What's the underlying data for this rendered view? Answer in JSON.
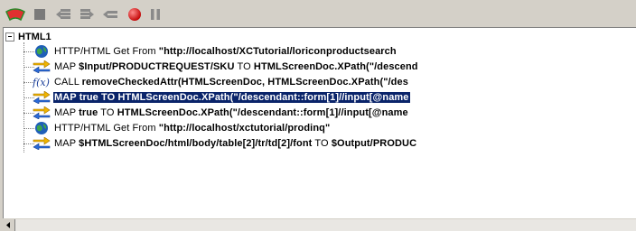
{
  "toolbar": {
    "buttons": [
      {
        "icon": "step-icon"
      },
      {
        "icon": "stop-square-icon"
      },
      {
        "icon": "step-into-icon"
      },
      {
        "icon": "step-over-icon"
      },
      {
        "icon": "step-out-icon"
      },
      {
        "icon": "breakpoint-icon"
      },
      {
        "icon": "pause-icon"
      }
    ]
  },
  "tree": {
    "root_label": "HTML1",
    "items": [
      {
        "icon": "globe-icon",
        "parts": [
          {
            "t": " HTTP/HTML Get From ",
            "b": false
          },
          {
            "t": "\"http://localhost/XCTutorial/loriconproductsearch",
            "b": true
          }
        ]
      },
      {
        "icon": "map-arrows-icon",
        "parts": [
          {
            "t": "MAP ",
            "b": false
          },
          {
            "t": "$Input/PRODUCTREQUEST/SKU",
            "b": true
          },
          {
            "t": " TO ",
            "b": false
          },
          {
            "t": "HTMLScreenDoc.XPath(\"/descend",
            "b": true
          }
        ]
      },
      {
        "icon": "function-icon",
        "parts": [
          {
            "t": "CALL ",
            "b": false
          },
          {
            "t": "removeCheckedAttr(HTMLScreenDoc, HTMLScreenDoc.XPath(\"/des",
            "b": true
          }
        ]
      },
      {
        "icon": "map-arrows-icon",
        "selected": true,
        "parts": [
          {
            "t": "MAP true TO HTMLScreenDoc.XPath(\"/descendant::form[1]//input[@name",
            "b": true
          }
        ]
      },
      {
        "icon": "map-arrows-icon",
        "parts": [
          {
            "t": "MAP ",
            "b": false
          },
          {
            "t": "true",
            "b": true
          },
          {
            "t": " TO ",
            "b": false
          },
          {
            "t": "HTMLScreenDoc.XPath(\"/descendant::form[1]//input[@name",
            "b": true
          }
        ]
      },
      {
        "icon": "globe-icon",
        "parts": [
          {
            "t": " HTTP/HTML Get From ",
            "b": false
          },
          {
            "t": "\"http://localhost/xctutorial/prodinq\"",
            "b": true
          }
        ]
      },
      {
        "icon": "map-arrows-icon",
        "parts": [
          {
            "t": "MAP ",
            "b": false
          },
          {
            "t": "$HTMLScreenDoc/html/body/table[2]/tr/td[2]/font",
            "b": true
          },
          {
            "t": " TO ",
            "b": false
          },
          {
            "t": "$Output/PRODUC",
            "b": true
          }
        ]
      }
    ]
  }
}
